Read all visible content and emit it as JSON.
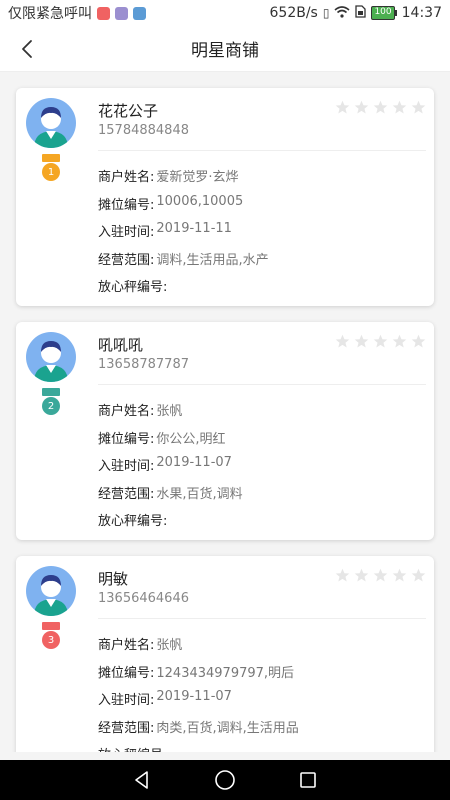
{
  "status_bar": {
    "carrier": "仅限紧急呼叫",
    "network_speed": "652B/s",
    "battery": "100",
    "time": "14:37",
    "icons": [
      "notification-icon",
      "vibrate-icon",
      "wifi-icon",
      "sim-icon",
      "battery-icon"
    ]
  },
  "header": {
    "title": "明星商铺",
    "back_icon": "chevron-left-icon"
  },
  "labels": {
    "merchant_name": "商户姓名:",
    "stall_no": "摊位编号:",
    "join_date": "入驻时间:",
    "scope": "经营范围:",
    "scale_no": "放心秤编号:"
  },
  "merchants": [
    {
      "name": "花花公子",
      "phone": "15784884848",
      "rank": "1",
      "medal_color": "#f5a623",
      "merchant_name": "爱新觉罗·玄烨",
      "stall_no": "10006,10005",
      "join_date": "2019-11-11",
      "scope": "调料,生活用品,水产",
      "scale_no": "",
      "rating": 0
    },
    {
      "name": "吼吼吼",
      "phone": "13658787787",
      "rank": "2",
      "medal_color": "#3aa89a",
      "merchant_name": "张帆",
      "stall_no": "你公公,明红",
      "join_date": "2019-11-07",
      "scope": "水果,百货,调料",
      "scale_no": "",
      "rating": 0
    },
    {
      "name": "明敏",
      "phone": "13656464646",
      "rank": "3",
      "medal_color": "#f06262",
      "merchant_name": "张帆",
      "stall_no": "1243434979797,明后",
      "join_date": "2019-11-07",
      "scope": "肉类,百货,调料,生活用品",
      "scale_no": "",
      "rating": 0
    }
  ],
  "colors": {
    "avatar_bg": "#7fb2f0",
    "star_empty": "#e6e6e6"
  }
}
